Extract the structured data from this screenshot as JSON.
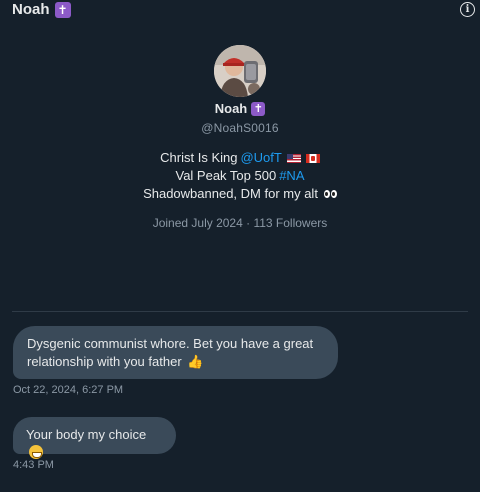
{
  "header": {
    "name": "Noah",
    "badge": "✝",
    "info_icon": "info-icon",
    "info_glyph": "i"
  },
  "profile": {
    "avatar_icon": "avatar",
    "name": "Noah",
    "badge": "✝",
    "handle": "@NoahS0016",
    "bio": {
      "line1_prefix": "Christ Is King ",
      "line1_link": "@UofT",
      "line2_prefix": "Val Peak Top 500 ",
      "line2_link": "#NA",
      "line3": "Shadowbanned, DM for my alt"
    },
    "meta": "Joined July 2024 · 113 Followers"
  },
  "messages": [
    {
      "text": "Dysgenic communist whore. Bet you have a great relationship with you father",
      "emoji": "👍",
      "timestamp": "Oct 22, 2024, 6:27 PM"
    },
    {
      "text": "Your body my choice",
      "timestamp": "4:43 PM"
    }
  ],
  "colors": {
    "background": "#15202b",
    "bubble": "#3a4a59",
    "link": "#1d9bf0",
    "muted": "#8b98a5",
    "badge": "#8c5ac8"
  }
}
